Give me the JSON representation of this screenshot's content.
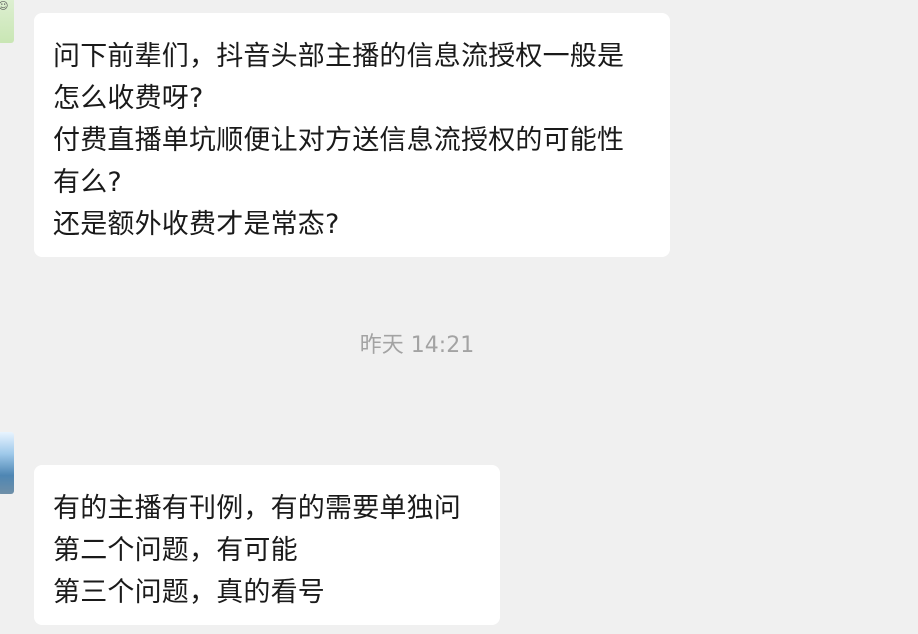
{
  "conversation": {
    "messages": [
      {
        "lines": [
          "问下前辈们，抖音头部主播的信息流授权一般是",
          "怎么收费呀?",
          "付费直播单坑顺便让对方送信息流授权的可能性",
          "有么?",
          "还是额外收费才是常态?"
        ]
      },
      {
        "lines": [
          "有的主播有刊例，有的需要单独问",
          "第二个问题，有可能",
          "第三个问题，真的看号"
        ]
      }
    ],
    "timestamp": "昨天 14:21"
  }
}
